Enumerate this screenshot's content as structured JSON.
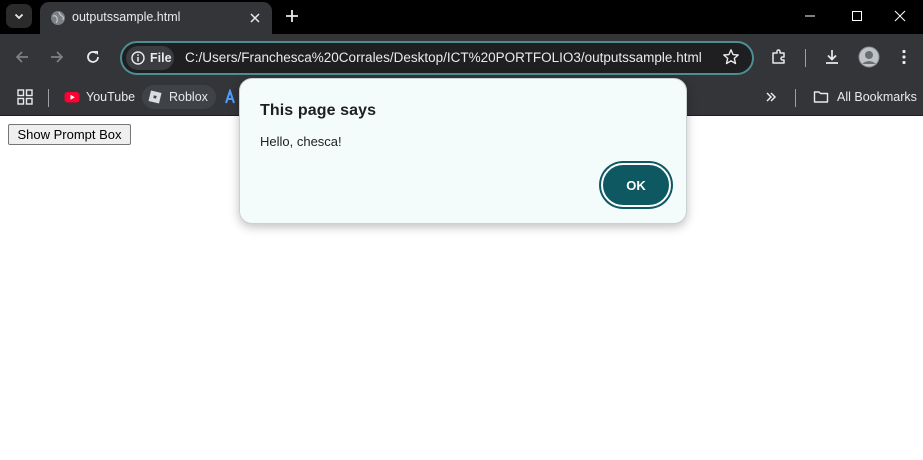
{
  "tab": {
    "title": "outputssample.html"
  },
  "toolbar": {
    "chip_label": "File",
    "url": "C:/Users/Franchesca%20Corrales/Desktop/ICT%20PORTFOLIO3/outputssample.html"
  },
  "bookmarks": {
    "items": [
      {
        "label": "YouTube",
        "icon": "youtube-icon"
      },
      {
        "label": "Roblox",
        "icon": "roblox-icon"
      }
    ],
    "all_label": "All Bookmarks"
  },
  "page": {
    "button_label": "Show Prompt Box"
  },
  "dialog": {
    "title": "This page says",
    "message": "Hello, chesca!",
    "ok_label": "OK"
  },
  "colors": {
    "accent": "#0e5961",
    "omnibox_border": "#4c8f93",
    "dialog_bg": "#f4fbfb",
    "youtube": "#ff0033"
  }
}
